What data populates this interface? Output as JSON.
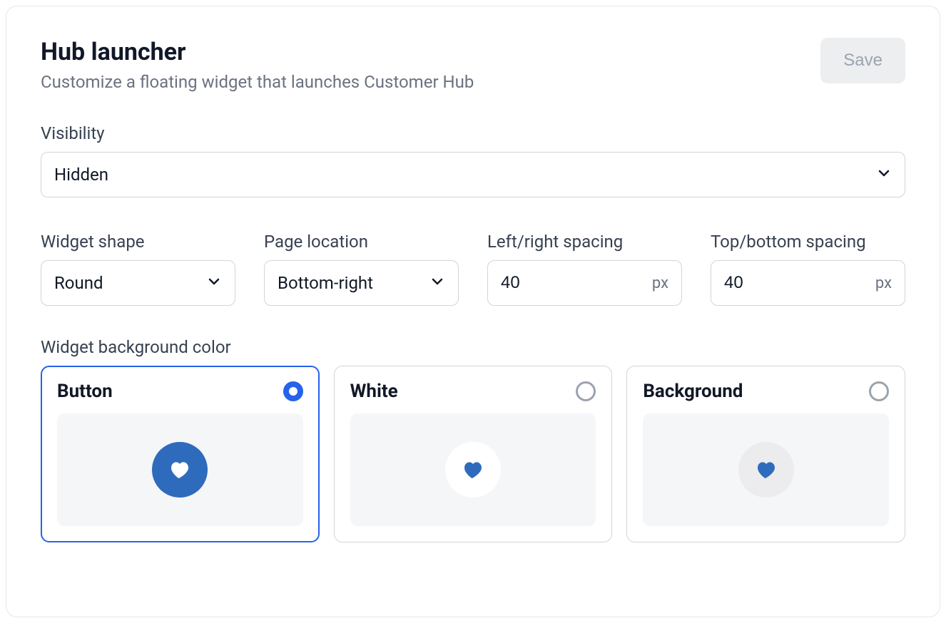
{
  "header": {
    "title": "Hub launcher",
    "subtitle": "Customize a floating widget that launches Customer Hub",
    "save_label": "Save"
  },
  "visibility": {
    "label": "Visibility",
    "value": "Hidden"
  },
  "widget_shape": {
    "label": "Widget shape",
    "value": "Round"
  },
  "page_location": {
    "label": "Page location",
    "value": "Bottom-right"
  },
  "left_right_spacing": {
    "label": "Left/right spacing",
    "value": "40",
    "unit": "px"
  },
  "top_bottom_spacing": {
    "label": "Top/bottom spacing",
    "value": "40",
    "unit": "px"
  },
  "bg_color": {
    "label": "Widget background color",
    "options": [
      {
        "label": "Button",
        "selected": true,
        "circle": "blue",
        "heart": "white"
      },
      {
        "label": "White",
        "selected": false,
        "circle": "white",
        "heart": "blue"
      },
      {
        "label": "Background",
        "selected": false,
        "circle": "grey",
        "heart": "blue"
      }
    ]
  },
  "colors": {
    "accent": "#2563eb",
    "brand_blue": "#2f6bbd"
  }
}
